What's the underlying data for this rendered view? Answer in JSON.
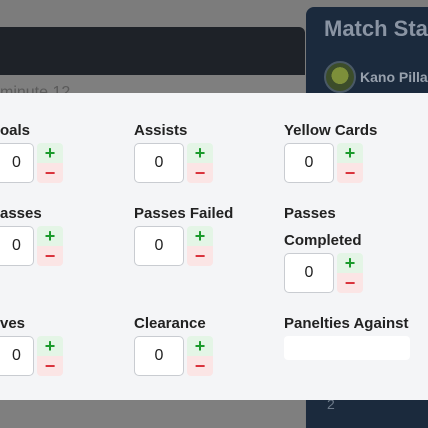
{
  "background": {
    "match_panel_title": "Match Sta",
    "team_name": "Kano Pilla",
    "minute_text": "minute 12",
    "bottom_number": "2"
  },
  "modal": {
    "fields": {
      "goals": {
        "label": "oals",
        "value": "0"
      },
      "assists": {
        "label": "Assists",
        "value": "0"
      },
      "yellow_cards": {
        "label": "Yellow Cards",
        "value": "0"
      },
      "passes": {
        "label": "asses",
        "value": "0"
      },
      "passes_failed": {
        "label": "Passes Failed",
        "value": "0"
      },
      "passes_completed": {
        "label_line1": "Passes",
        "label_line2": "Completed",
        "value": "0"
      },
      "saves": {
        "label": "ves",
        "value": "0"
      },
      "clearance": {
        "label": "Clearance",
        "value": "0"
      },
      "penalties_against": {
        "label": "Panelties Against"
      }
    },
    "plus_symbol": "+",
    "minus_symbol": "−"
  },
  "colors": {
    "plus": "#1a9a2b",
    "minus": "#d9313a",
    "modal_bg": "#f4f5f7"
  }
}
